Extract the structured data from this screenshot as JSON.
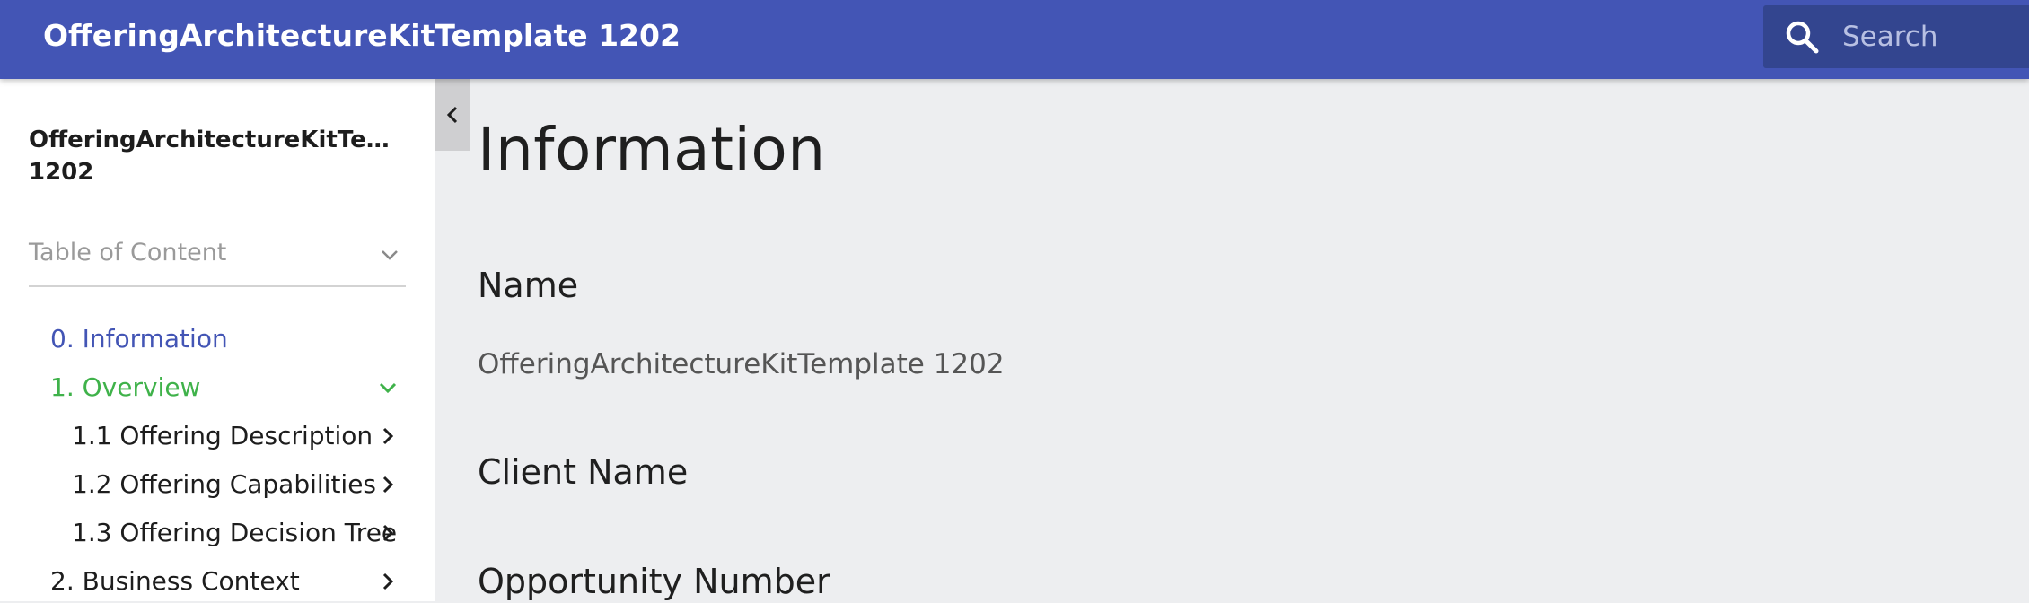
{
  "header": {
    "title": "OfferingArchitectureKitTemplate 1202",
    "search_placeholder": "Search",
    "search_icon": "search-icon"
  },
  "sidebar": {
    "title_line1": "OfferingArchitectureKitTempl...",
    "title_line2": "1202",
    "toc_label": "Table of Content",
    "items": [
      {
        "label": "0. Information",
        "color": "#4355b5"
      },
      {
        "label": "1. Overview",
        "color": "#3fb24a",
        "icon": "chevron-down-icon"
      },
      {
        "label": "1.1 Offering Description",
        "icon": "chevron-right-icon"
      },
      {
        "label": "1.2 Offering Capabilities",
        "icon": "chevron-right-icon"
      },
      {
        "label": "1.3 Offering Decision Tree",
        "icon": "chevron-right-icon"
      },
      {
        "label": "2. Business Context",
        "icon": "chevron-right-icon"
      }
    ]
  },
  "main": {
    "title": "Information",
    "sections": [
      {
        "heading": "Name",
        "value": "OfferingArchitectureKitTemplate 1202"
      },
      {
        "heading": "Client Name",
        "value": ""
      },
      {
        "heading": "Opportunity Number",
        "value": ""
      }
    ]
  },
  "colors": {
    "header_bg": "#4355b5",
    "search_bg": "#33458f",
    "active_link": "#4355b5",
    "expanded_item": "#3fb24a",
    "content_bg": "#edeef0"
  }
}
